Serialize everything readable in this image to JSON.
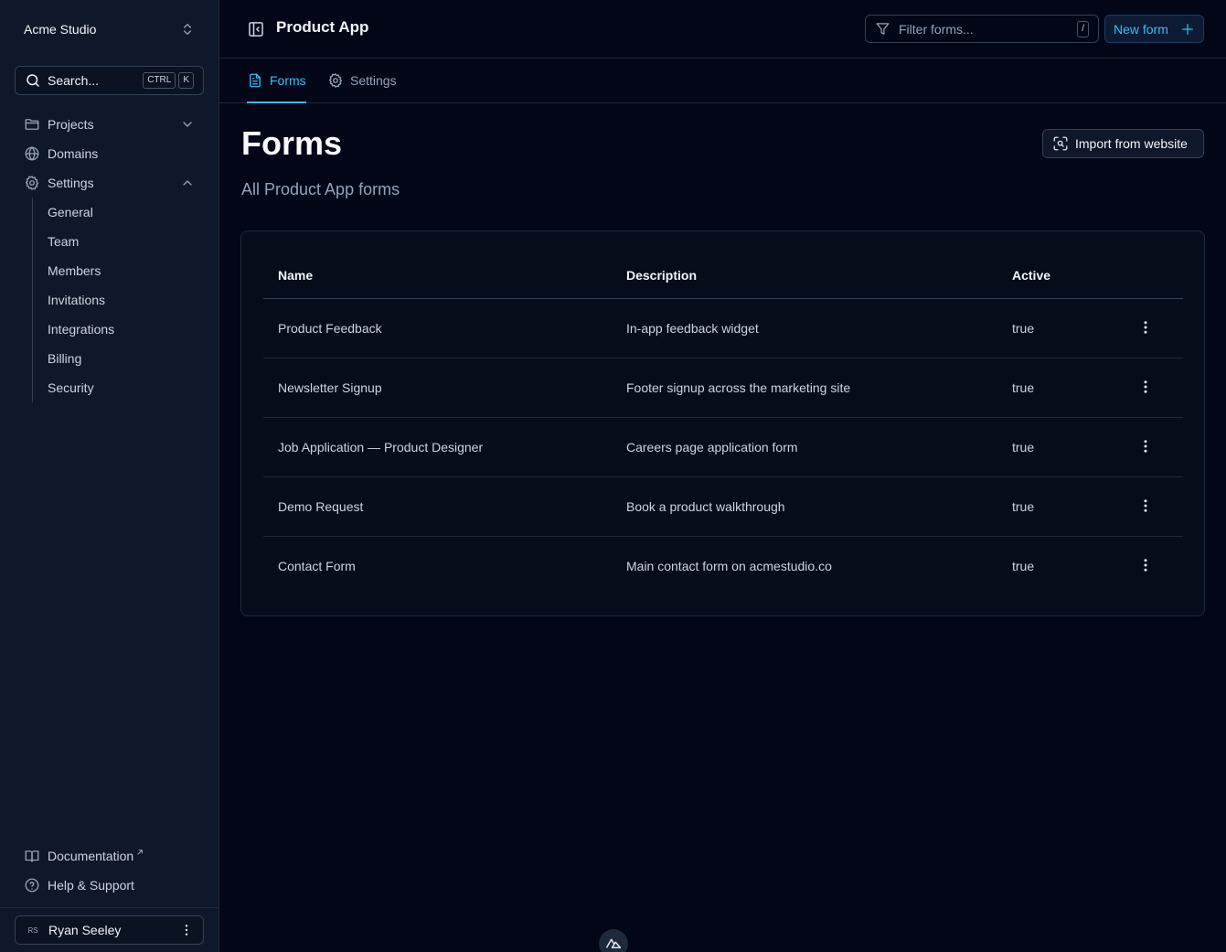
{
  "workspace": {
    "name": "Acme Studio"
  },
  "search": {
    "label": "Search...",
    "shortcut": [
      "CTRL",
      "K"
    ]
  },
  "sidebar": {
    "items": [
      {
        "label": "Projects",
        "icon": "folder-icon"
      },
      {
        "label": "Domains",
        "icon": "globe-icon"
      },
      {
        "label": "Settings",
        "icon": "gear-icon"
      }
    ],
    "settings_children": [
      "General",
      "Team",
      "Members",
      "Invitations",
      "Integrations",
      "Billing",
      "Security"
    ],
    "footer": [
      {
        "label": "Documentation",
        "icon": "book-icon",
        "external": true
      },
      {
        "label": "Help & Support",
        "icon": "help-circle-icon"
      }
    ]
  },
  "user": {
    "initials": "RS",
    "name": "Ryan Seeley"
  },
  "header": {
    "title": "Product App",
    "filter_placeholder": "Filter forms...",
    "filter_shortcut": "/",
    "new_form_label": "New form"
  },
  "tabs": [
    {
      "label": "Forms",
      "active": true
    },
    {
      "label": "Settings",
      "active": false
    }
  ],
  "page": {
    "title": "Forms",
    "subtitle": "All Product App forms",
    "import_label": "Import from website"
  },
  "table": {
    "columns": [
      "Name",
      "Description",
      "Active"
    ],
    "rows": [
      {
        "name": "Product Feedback",
        "description": "In-app feedback widget",
        "active": "true"
      },
      {
        "name": "Newsletter Signup",
        "description": "Footer signup across the marketing site",
        "active": "true"
      },
      {
        "name": "Job Application — Product Designer",
        "description": "Careers page application form",
        "active": "true"
      },
      {
        "name": "Demo Request",
        "description": "Book a product walkthrough",
        "active": "true"
      },
      {
        "name": "Contact Form",
        "description": "Main contact form on acmestudio.co",
        "active": "true"
      }
    ]
  },
  "theme": {
    "accent": "#38bdf8",
    "background": "#020617",
    "sidebar": "#0f172a"
  }
}
